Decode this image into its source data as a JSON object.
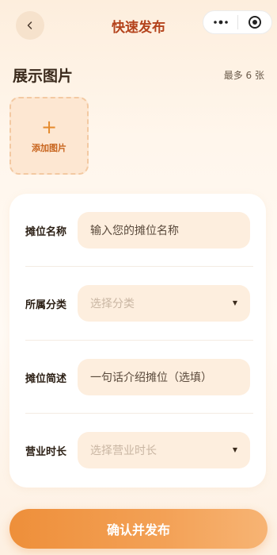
{
  "nav": {
    "title": "快速发布",
    "back_icon": "chevron-left-icon",
    "more_icon": "more-dots-icon",
    "close_icon": "target-close-icon"
  },
  "images_section": {
    "title": "展示图片",
    "limit_hint": "最多 6 张",
    "add_icon": "plus-icon",
    "add_label": "添加图片"
  },
  "form": {
    "stall_name": {
      "label": "摊位名称",
      "placeholder": "输入您的摊位名称"
    },
    "category": {
      "label": "所属分类",
      "placeholder": "选择分类"
    },
    "description": {
      "label": "摊位简述",
      "placeholder": "一句话介绍摊位（选填）"
    },
    "business_hours": {
      "label": "营业时长",
      "placeholder": "选择营业时长"
    }
  },
  "confirm_button": {
    "label": "确认并发布"
  },
  "colors": {
    "accent": "#ee8f3a",
    "title": "#b4431c",
    "field_bg": "#fdeede"
  }
}
